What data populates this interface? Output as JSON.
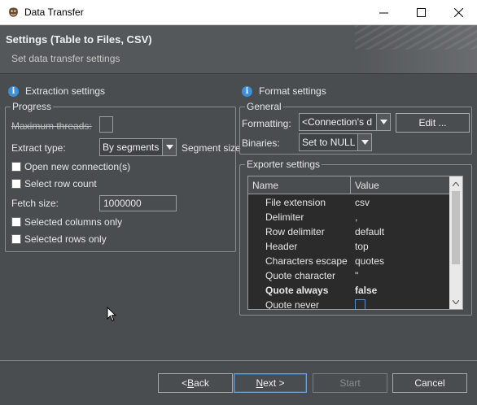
{
  "window": {
    "title": "Data Transfer"
  },
  "header": {
    "title": "Settings (Table to Files, CSV)",
    "subtitle": "Set data transfer settings"
  },
  "extraction": {
    "section_label": "Extraction settings",
    "group_label": "Progress",
    "max_threads_label": "Maximum threads:",
    "max_threads_value": "",
    "extract_type_label": "Extract type:",
    "extract_type_value": "By segments",
    "segment_size_label": "Segment size",
    "open_new_connection_label": "Open new connection(s)",
    "select_row_count_label": "Select row count",
    "fetch_size_label": "Fetch size:",
    "fetch_size_value": "1000000",
    "selected_columns_only_label": "Selected columns only",
    "selected_rows_only_label": "Selected rows only"
  },
  "format": {
    "section_label": "Format settings",
    "general_label": "General",
    "formatting_label": "Formatting:",
    "formatting_value": "<Connection's d",
    "edit_button_label": "Edit ...",
    "binaries_label": "Binaries:",
    "binaries_value": "Set to NULL",
    "exporter_label": "Exporter settings",
    "table": {
      "columns": [
        "Name",
        "Value"
      ],
      "rows": [
        {
          "name": "File extension",
          "value": "csv"
        },
        {
          "name": "Delimiter",
          "value": ","
        },
        {
          "name": "Row delimiter",
          "value": "default"
        },
        {
          "name": "Header",
          "value": "top"
        },
        {
          "name": "Characters escape",
          "value": "quotes"
        },
        {
          "name": "Quote character",
          "value": "\""
        },
        {
          "name": "Quote always",
          "value": "false"
        },
        {
          "name": "Quote never",
          "value": ""
        }
      ]
    }
  },
  "footer": {
    "back_label": "< Back",
    "next_label": "Next >",
    "start_label": "Start",
    "cancel_label": "Cancel"
  },
  "colors": {
    "accent": "#3c8fd9",
    "background": "#4a4d4f",
    "table_bg": "#2b2b2b"
  }
}
